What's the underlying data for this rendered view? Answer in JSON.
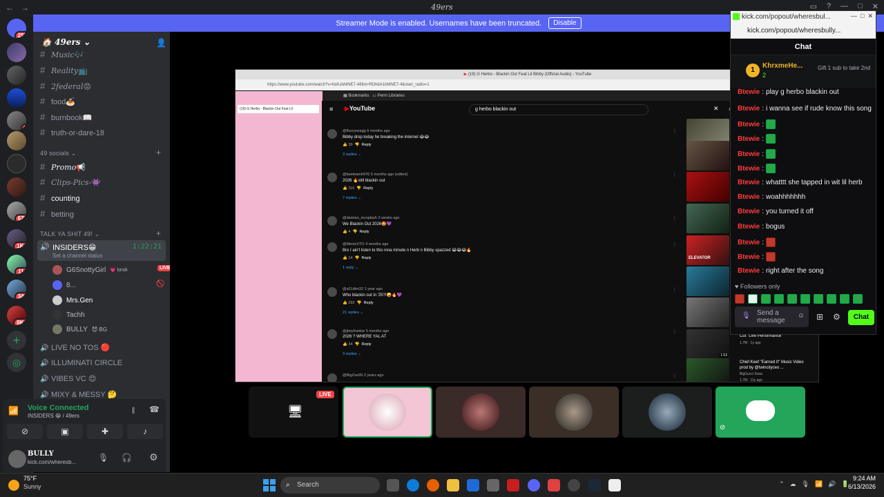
{
  "window": {
    "title": "49ers"
  },
  "banner": {
    "text": "Streamer Mode is enabled. Usernames have been truncated.",
    "button": "Disable"
  },
  "servers": {
    "badges": [
      "257",
      "5",
      "679",
      "1K+",
      "114",
      "346",
      "8K+"
    ]
  },
  "server": {
    "name": "49ers"
  },
  "channels": [
    {
      "name": "Music",
      "emoji": "🎶"
    },
    {
      "name": "Reality",
      "emoji": "📺"
    },
    {
      "name": "2federal",
      "emoji": "😡"
    },
    {
      "name": "food",
      "emoji": "🍝"
    },
    {
      "name": "burnbook",
      "emoji": "📖"
    },
    {
      "name": "truth-or-dare-18",
      "emoji": ""
    }
  ],
  "category_socials": "49 socials",
  "channels2": [
    {
      "name": "Promo",
      "emoji": "📢"
    },
    {
      "name": "Clips-Pics-",
      "emoji": "👾"
    },
    {
      "name": "counting",
      "emoji": ""
    },
    {
      "name": "betting",
      "emoji": ""
    }
  ],
  "category_talk": "TALK YA SHIT 49!",
  "voice": {
    "channel": "INSIDERS",
    "emoji": "😁",
    "timer": "1:22:21",
    "status": "Set a channel status",
    "users": [
      {
        "name": "G6SnottyGirl",
        "tag": "💗 bnsk",
        "live": "LIVE"
      },
      {
        "name": "8..."
      },
      {
        "name": "Mrs.Gen"
      },
      {
        "name": "Tachh"
      },
      {
        "name": "BULLY",
        "tag": "😈 BG"
      }
    ]
  },
  "voice_channels": [
    {
      "name": "LIVE NO TOS",
      "emoji": "🔴"
    },
    {
      "name": "ILLUMINATI CIRCLE",
      "emoji": ""
    },
    {
      "name": "VIBES VC",
      "emoji": "😍"
    },
    {
      "name": "MIXY & MESSY",
      "emoji": "🤔"
    }
  ],
  "voice_panel": {
    "title": "Voice Connected",
    "sub": "INSIDERS 😁 / 49ers"
  },
  "user_panel": {
    "name": "BULLY",
    "status": "kick.com/wheresb..."
  },
  "stream": {
    "tab_title": "(19) G Herbo - Blackin Out Feat Lil Bibby (Official Audio) - YouTube",
    "url": "https://www.youtube.com/watch?v=hdA1bMNE7-48list=RDhdA1bMNE7-4&start_radio=1",
    "side_tab": "(19) G Herbo - Blackin Out Feat Lil",
    "bookmarks": "Bookmarks",
    "perm": "Perm Libraries",
    "logo": "YouTube",
    "query": "g herbo blackin out",
    "comments": [
      {
        "user": "@flizzyswagg",
        "time": "6 months ago",
        "text": "Bibby drop today he breaking the internet 😂😂",
        "likes": "39",
        "replies": "3 replies"
      },
      {
        "user": "@bambam6476",
        "time": "5 months ago (edited)",
        "text": "2026 🔥still blackin out",
        "likes": "116",
        "replies": "7 replies"
      },
      {
        "user": "@damian_mcsplash",
        "time": "2 weeks ago",
        "text": "We Blackin Out 2026🤩💜",
        "likes": "4",
        "replies": ""
      },
      {
        "user": "@MenisXTO",
        "time": "4 months ago",
        "text": "Bro I ain't listen to this inna minute n Herb n Bibby spazzed 😂😂😂🔥",
        "likes": "14",
        "replies": "1 reply"
      },
      {
        "user": "@a51dtm32",
        "time": "1 year ago",
        "text": "Who blackin out in '25?!🤪🔥💜",
        "likes": "292",
        "replies": "21 replies"
      },
      {
        "user": "@jboyfrankie",
        "time": "5 months ago",
        "text": "2026 ? WHERE YAL AT",
        "likes": "34",
        "replies": "3 replies"
      },
      {
        "user": "@BigZoe99",
        "time": "2 years ago",
        "text": "",
        "likes": "",
        "replies": ""
      }
    ],
    "reply_label": "Reply",
    "related": [
      {
        "title": "Cut\" Live Performance",
        "meta": "1.7M · 1y ago",
        "dur": "1:53"
      },
      {
        "title": "Chief Keef \"Earned It\" Music Video prod by @twincityceo ...",
        "channel": "BigGucci Sosa",
        "meta": "1.7M · 11y ago"
      }
    ],
    "thumb_text": "ELEVATOR"
  },
  "tiles": {
    "live": "LIVE"
  },
  "chat": {
    "window_title": "kick.com/popout/wheresbul...",
    "address": "kick.com/popout/wheresbully...",
    "title": "Chat",
    "pinned_user": "KhrxmeHe...",
    "pinned_count": "2",
    "gift": "Gift 1 sub to take 2nd",
    "messages": [
      {
        "user": "Btewie",
        "text": "play g herbo blackin out"
      },
      {
        "user": "Btewie",
        "text": "i wanna see if rude know this song"
      },
      {
        "user": "Btewie",
        "text": "",
        "emote": "green"
      },
      {
        "user": "Btewie",
        "text": "",
        "emote": "green"
      },
      {
        "user": "Btewie",
        "text": "",
        "emote": "green"
      },
      {
        "user": "Btewie",
        "text": "",
        "emote": "green"
      },
      {
        "user": "Btewie",
        "text": "whatttt she tapped in wit lil herb"
      },
      {
        "user": "Btewie",
        "text": "woahhhhhhh"
      },
      {
        "user": "Btewie",
        "text": "you turned it off"
      },
      {
        "user": "Btewie",
        "text": "bogus"
      },
      {
        "user": "Btewie",
        "text": "",
        "emote": "red"
      },
      {
        "user": "Btewie",
        "text": "",
        "emote": "red"
      },
      {
        "user": "Btewie",
        "text": "right after the song"
      }
    ],
    "followers_only": "Followers only",
    "input_placeholder": "Send a message",
    "send": "Chat"
  },
  "taskbar": {
    "temp": "75°F",
    "weather": "Sunny",
    "search": "Search",
    "time": "9:24 AM",
    "date": "6/13/2026"
  }
}
